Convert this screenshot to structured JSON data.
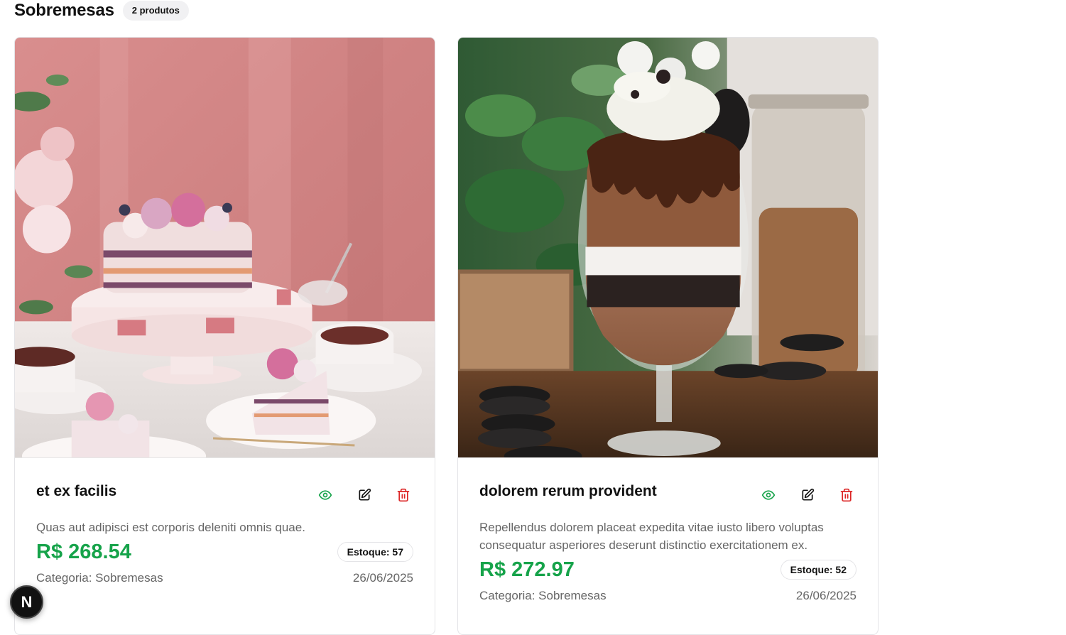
{
  "section": {
    "title": "Sobremesas",
    "count": "2 produtos"
  },
  "products": [
    {
      "name": "et ex facilis",
      "description": "Quas aut adipisci est corporis deleniti omnis quae.",
      "price": "R$ 268.54",
      "stock": "Estoque: 57",
      "category": "Categoria: Sobremesas",
      "date": "26/06/2025"
    },
    {
      "name": "dolorem rerum provident",
      "description": "Repellendus dolorem placeat expedita vitae iusto libero voluptas consequatur asperiores deserunt distinctio exercitationem ex.",
      "price": "R$ 272.97",
      "stock": "Estoque: 52",
      "category": "Categoria: Sobremesas",
      "date": "26/06/2025"
    }
  ],
  "dev_badge": {
    "letter": "N"
  },
  "colors": {
    "price": "#16a34a",
    "view_icon": "#16a34a",
    "edit_icon": "#111111",
    "delete_icon": "#dc2626"
  },
  "icons": {
    "view": "eye-icon",
    "edit": "edit-icon",
    "delete": "trash-icon"
  }
}
